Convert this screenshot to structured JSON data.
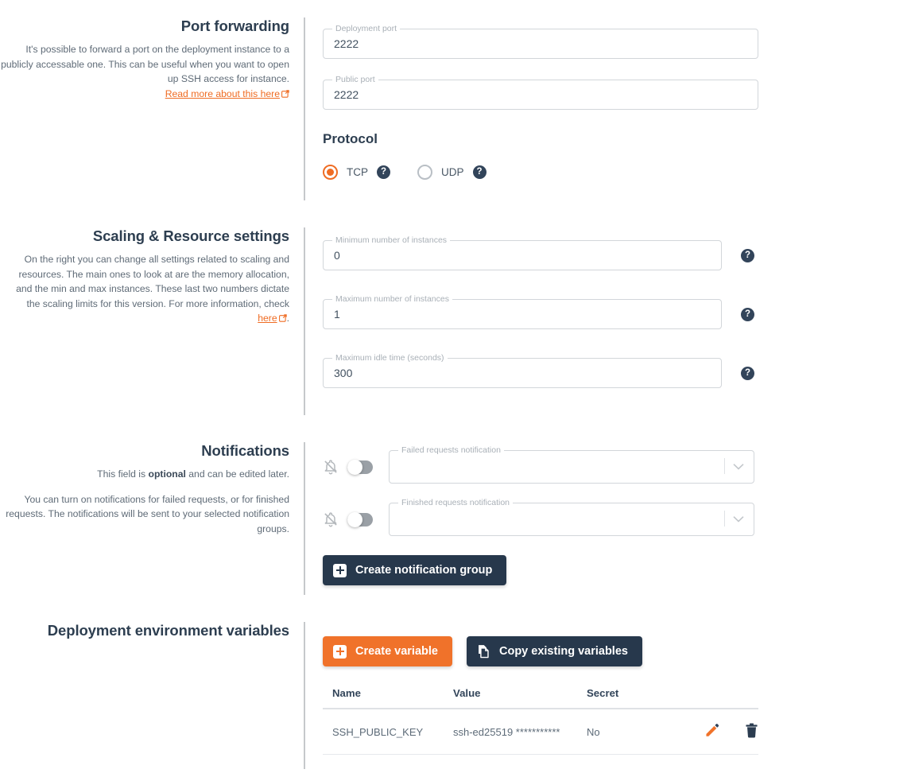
{
  "sections": {
    "port_forwarding": {
      "title": "Port forwarding",
      "desc": "It's possible to forward a port on the deployment instance to a publicly accessable one. This can be useful when you want to open up SSH access for instance.",
      "link_text": "Read more about this here",
      "link_icon": "external-link-icon",
      "fields": [
        {
          "label": "Deployment port",
          "value": "2222"
        },
        {
          "label": "Public port",
          "value": "2222"
        }
      ],
      "protocol": {
        "title": "Protocol",
        "options": [
          {
            "label": "TCP",
            "selected": true,
            "help_icon": "help-circle-icon"
          },
          {
            "label": "UDP",
            "selected": false,
            "help_icon": "help-circle-icon"
          }
        ]
      }
    },
    "scaling": {
      "title": "Scaling & Resource settings",
      "desc_before_link": "On the right you can change all settings related to scaling and resources. The main ones to look at are the memory allocation, and the min and max instances. These last two numbers dictate the scaling limits for this version. For more information, check ",
      "link_text": "here",
      "desc_after_link": ".",
      "fields": [
        {
          "label": "Minimum number of instances",
          "value": "0",
          "help_icon": "help-circle-icon"
        },
        {
          "label": "Maximum number of instances",
          "value": "1",
          "help_icon": "help-circle-icon"
        },
        {
          "label": "Maximum idle time (seconds)",
          "value": "300",
          "help_icon": "help-circle-icon"
        }
      ]
    },
    "notifications": {
      "title": "Notifications",
      "desc1_a": "This field is ",
      "desc1_bold": "optional",
      "desc1_b": " and can be edited later.",
      "desc2": "You can turn on notifications for failed requests, or for finished requests. The notifications will be sent to your selected notification groups.",
      "rows": [
        {
          "bell_icon": "bell-off-icon",
          "toggle_on": false,
          "label": "Failed requests notification",
          "value": ""
        },
        {
          "bell_icon": "bell-off-icon",
          "toggle_on": false,
          "label": "Finished requests notification",
          "value": ""
        }
      ],
      "create_group_button": "Create notification group",
      "create_group_icon": "plus-square-icon"
    },
    "env_vars": {
      "title": "Deployment environment variables",
      "create_button": "Create variable",
      "create_icon": "plus-square-icon",
      "copy_button": "Copy existing variables",
      "copy_icon": "copy-icon",
      "columns": [
        "Name",
        "Value",
        "Secret"
      ],
      "rows": [
        {
          "name": "SSH_PUBLIC_KEY",
          "value": "ssh-ed25519 ***********",
          "secret": "No",
          "edit_icon": "pencil-icon",
          "delete_icon": "trash-icon"
        }
      ]
    }
  },
  "colors": {
    "accent_orange": "#ef6c23",
    "dark_navy": "#27384c",
    "divider_gray": "#c6c8cb"
  }
}
